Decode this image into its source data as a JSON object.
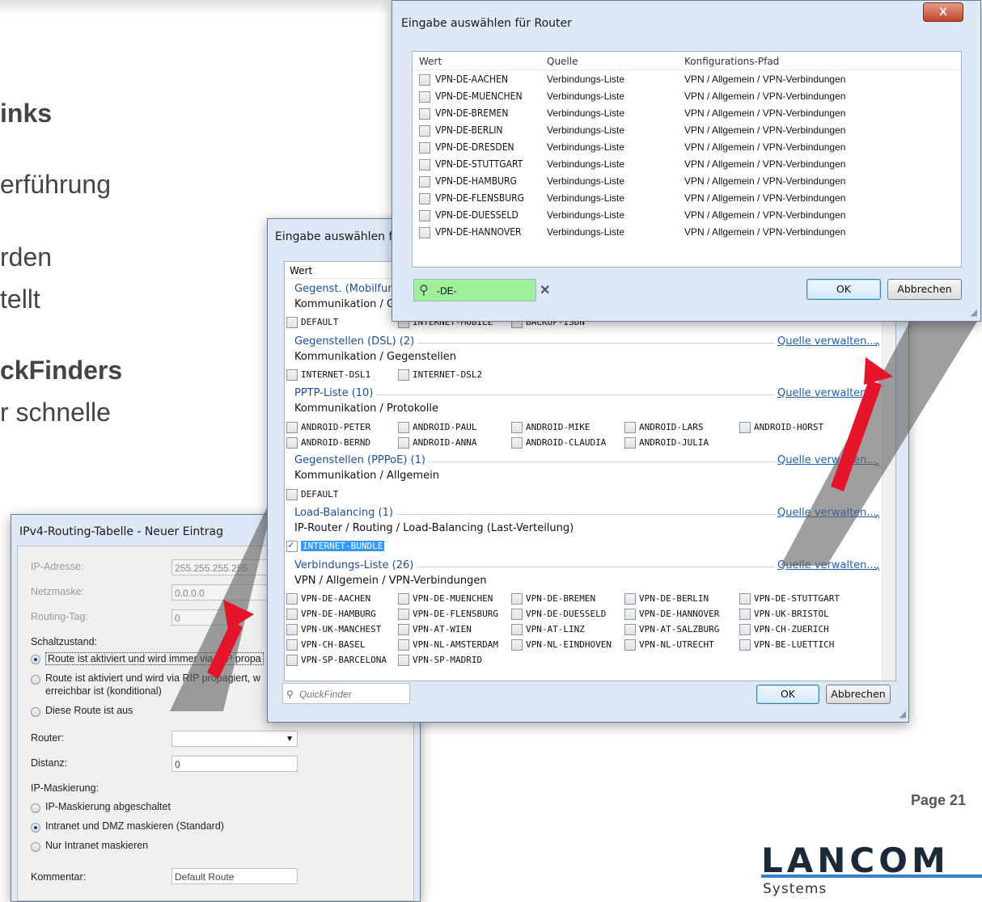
{
  "slide": {
    "text_lines": [
      {
        "text": "inks",
        "bold": true
      },
      {
        "text": "erführung",
        "bold": false
      },
      {
        "text": "rden",
        "bold": false
      },
      {
        "text": "tellt",
        "bold": false
      },
      {
        "text": "ckFinders",
        "bold": true
      },
      {
        "text": "r schnelle",
        "bold": false
      }
    ],
    "page_label": "Page 21",
    "logo": "LANCOM",
    "logo_sub": "Systems",
    "logo_line_color": "#3d7cc9"
  },
  "routing_dialog": {
    "title": "IPv4-Routing-Tabelle - Neuer Eintrag",
    "ip_label": "IP-Adresse:",
    "ip_value": "255.255.255.255",
    "mask_label": "Netzmaske:",
    "mask_value": "0.0.0.0",
    "tag_label": "Routing-Tag:",
    "tag_value": "0",
    "state_label": "Schaltzustand:",
    "state_options": [
      {
        "label": "Route ist aktiviert und wird immer via RIP propa",
        "selected": true
      },
      {
        "label": "Route ist aktiviert und wird via RIP propagiert, w",
        "selected": false
      },
      {
        "label": "Diese Route ist aus",
        "selected": false
      }
    ],
    "state_option2_line2": "erreichbar ist (konditional)",
    "router_label": "Router:",
    "router_value": "",
    "distance_label": "Distanz:",
    "distance_value": "0",
    "masq_label": "IP-Maskierung:",
    "masq_options": [
      {
        "label": "IP-Maskierung abgeschaltet",
        "selected": false
      },
      {
        "label": "Intranet und DMZ maskieren (Standard)",
        "selected": true
      },
      {
        "label": "Nur Intranet maskieren",
        "selected": false
      }
    ],
    "comment_label": "Kommentar:",
    "comment_value": "Default Route"
  },
  "select_dialog": {
    "title": "Eingabe auswählen für I",
    "column_header": "Wert",
    "manage_link": "Quelle verwalten...",
    "sections": [
      {
        "heading": "Gegenst. (Mobilfun",
        "path": "Kommunikation / G",
        "items": [
          {
            "label": "DEFAULT",
            "checked": false
          },
          {
            "label": "INTERNET-MOBILE",
            "checked": false
          },
          {
            "label": "BACKUP-ISDN",
            "checked": false
          }
        ]
      },
      {
        "heading": "Gegenstellen (DSL) (2)",
        "path": "Kommunikation / Gegenstellen",
        "items": [
          {
            "label": "INTERNET-DSL1",
            "checked": false
          },
          {
            "label": "INTERNET-DSL2",
            "checked": false
          }
        ]
      },
      {
        "heading": "PPTP-Liste (10)",
        "path": "Kommunikation / Protokolle",
        "items": [
          {
            "label": "ANDROID-PETER",
            "checked": false
          },
          {
            "label": "ANDROID-PAUL",
            "checked": false
          },
          {
            "label": "ANDROID-MIKE",
            "checked": false
          },
          {
            "label": "ANDROID-LARS",
            "checked": false
          },
          {
            "label": "ANDROID-HORST",
            "checked": false
          },
          {
            "label": "ANDROID-BERND",
            "checked": false
          },
          {
            "label": "ANDROID-ANNA",
            "checked": false
          },
          {
            "label": "ANDROID-CLAUDIA",
            "checked": false
          },
          {
            "label": "ANDROID-JULIA",
            "checked": false
          }
        ]
      },
      {
        "heading": "Gegenstellen (PPPoE) (1)",
        "path": "Kommunikation / Allgemein",
        "items": [
          {
            "label": "DEFAULT",
            "checked": false
          }
        ]
      },
      {
        "heading": "Load-Balancing (1)",
        "path": "IP-Router / Routing / Load-Balancing (Last-Verteilung)",
        "items": [
          {
            "label": "INTERNET-BUNDLE",
            "checked": true
          }
        ]
      },
      {
        "heading": "Verbindungs-Liste (26)",
        "path": "VPN / Allgemein / VPN-Verbindungen",
        "items": [
          {
            "label": "VPN-DE-AACHEN"
          },
          {
            "label": "VPN-DE-MUENCHEN"
          },
          {
            "label": "VPN-DE-BREMEN"
          },
          {
            "label": "VPN-DE-BERLIN"
          },
          {
            "label": "VPN-DE-STUTTGART"
          },
          {
            "label": "VPN-DE-HAMBURG"
          },
          {
            "label": "VPN-DE-FLENSBURG"
          },
          {
            "label": "VPN-DE-DUESSELD"
          },
          {
            "label": "VPN-DE-HANNOVER"
          },
          {
            "label": "VPN-UK-BRISTOL"
          },
          {
            "label": "VPN-UK-MANCHEST"
          },
          {
            "label": "VPN-AT-WIEN"
          },
          {
            "label": "VPN-AT-LINZ"
          },
          {
            "label": "VPN-AT-SALZBURG"
          },
          {
            "label": "VPN-CH-ZUERICH"
          },
          {
            "label": "VPN-CH-BASEL"
          },
          {
            "label": "VPN-NL-AMSTERDAM"
          },
          {
            "label": "VPN-NL-EINDHOVEN"
          },
          {
            "label": "VPN-NL-UTRECHT"
          },
          {
            "label": "VPN-BE-LUETTICH"
          },
          {
            "label": "VPN-SP-BARCELONA"
          },
          {
            "label": "VPN-SP-MADRID"
          }
        ]
      }
    ],
    "quickfinder_placeholder": "QuickFinder",
    "ok_label": "OK",
    "cancel_label": "Abbrechen"
  },
  "router_dialog": {
    "title": "Eingabe auswählen für Router",
    "close_label": "X",
    "columns": [
      "Wert",
      "Quelle",
      "Konfigurations-Pfad"
    ],
    "rows": [
      {
        "wert": "VPN-DE-AACHEN",
        "quelle": "Verbindungs-Liste",
        "pfad": "VPN / Allgemein / VPN-Verbindungen"
      },
      {
        "wert": "VPN-DE-MUENCHEN",
        "quelle": "Verbindungs-Liste",
        "pfad": "VPN / Allgemein / VPN-Verbindungen"
      },
      {
        "wert": "VPN-DE-BREMEN",
        "quelle": "Verbindungs-Liste",
        "pfad": "VPN / Allgemein / VPN-Verbindungen"
      },
      {
        "wert": "VPN-DE-BERLIN",
        "quelle": "Verbindungs-Liste",
        "pfad": "VPN / Allgemein / VPN-Verbindungen"
      },
      {
        "wert": "VPN-DE-DRESDEN",
        "quelle": "Verbindungs-Liste",
        "pfad": "VPN / Allgemein / VPN-Verbindungen"
      },
      {
        "wert": "VPN-DE-STUTTGART",
        "quelle": "Verbindungs-Liste",
        "pfad": "VPN / Allgemein / VPN-Verbindungen"
      },
      {
        "wert": "VPN-DE-HAMBURG",
        "quelle": "Verbindungs-Liste",
        "pfad": "VPN / Allgemein / VPN-Verbindungen"
      },
      {
        "wert": "VPN-DE-FLENSBURG",
        "quelle": "Verbindungs-Liste",
        "pfad": "VPN / Allgemein / VPN-Verbindungen"
      },
      {
        "wert": "VPN-DE-DUESSELD",
        "quelle": "Verbindungs-Liste",
        "pfad": "VPN / Allgemein / VPN-Verbindungen"
      },
      {
        "wert": "VPN-DE-HANNOVER",
        "quelle": "Verbindungs-Liste",
        "pfad": "VPN / Allgemein / VPN-Verbindungen"
      }
    ],
    "search_value": "-DE-",
    "search_bg": "#9ff09a",
    "ok_label": "OK",
    "cancel_label": "Abbrechen"
  },
  "arrow_color": "#e4142b"
}
